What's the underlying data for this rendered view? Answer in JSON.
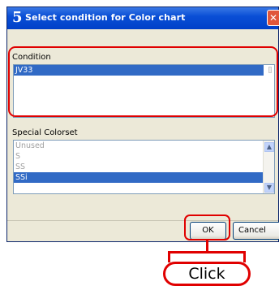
{
  "window": {
    "title_number": "5",
    "title": "Select condition for Color chart",
    "close_label": "✕"
  },
  "condition": {
    "label": "Condition",
    "items": [
      {
        "label": "JV33",
        "selected": true
      }
    ]
  },
  "special_colorset": {
    "label": "Special Colorset",
    "items": [
      {
        "label": "Unused",
        "selected": false
      },
      {
        "label": "S",
        "selected": false
      },
      {
        "label": "SS",
        "selected": false
      },
      {
        "label": "SSi",
        "selected": true
      }
    ]
  },
  "buttons": {
    "ok": "OK",
    "cancel": "Cancel"
  },
  "annotation": {
    "click": "Click",
    "color": "#e00000"
  },
  "colors": {
    "selection": "#316ac5",
    "titlebar": "#0a4fd6"
  }
}
